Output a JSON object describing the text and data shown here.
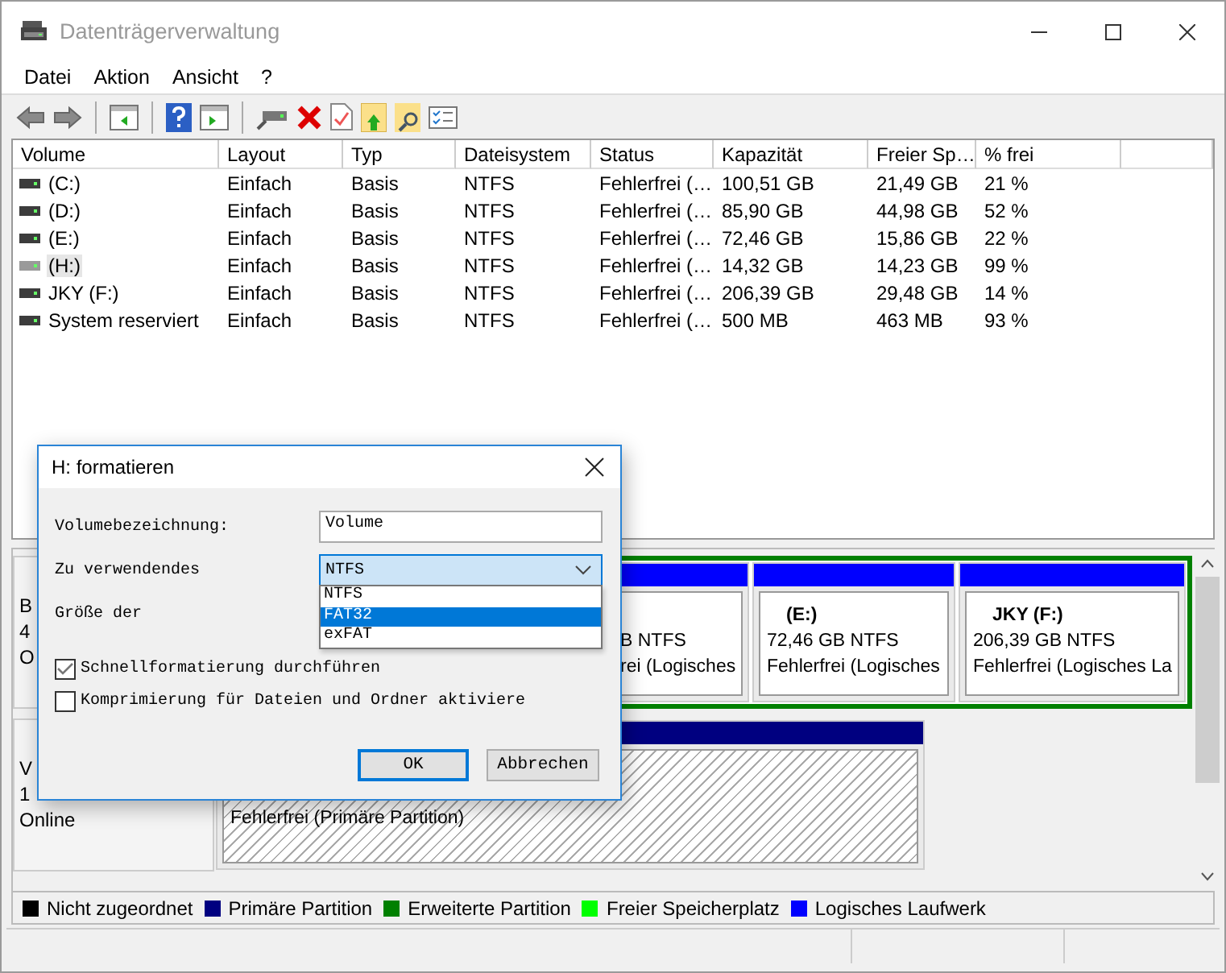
{
  "window": {
    "title": "Datenträgerverwaltung"
  },
  "menu": [
    "Datei",
    "Aktion",
    "Ansicht",
    "?"
  ],
  "volume_table": {
    "columns": [
      "Volume",
      "Layout",
      "Typ",
      "Dateisystem",
      "Status",
      "Kapazität",
      "Freier Sp…",
      "% frei"
    ],
    "rows": [
      {
        "volume": "(C:)",
        "layout": "Einfach",
        "type": "Basis",
        "filesystem": "NTFS",
        "status": "Fehlerfrei (…",
        "capacity": "100,51 GB",
        "free": "21,49 GB",
        "percent_free": "21 %",
        "selected": false
      },
      {
        "volume": "(D:)",
        "layout": "Einfach",
        "type": "Basis",
        "filesystem": "NTFS",
        "status": "Fehlerfrei (…",
        "capacity": "85,90 GB",
        "free": "44,98 GB",
        "percent_free": "52 %",
        "selected": false
      },
      {
        "volume": "(E:)",
        "layout": "Einfach",
        "type": "Basis",
        "filesystem": "NTFS",
        "status": "Fehlerfrei (…",
        "capacity": "72,46 GB",
        "free": "15,86 GB",
        "percent_free": "22 %",
        "selected": false
      },
      {
        "volume": "(H:)",
        "layout": "Einfach",
        "type": "Basis",
        "filesystem": "NTFS",
        "status": "Fehlerfrei (…",
        "capacity": "14,32 GB",
        "free": "14,23 GB",
        "percent_free": "99 %",
        "selected": true
      },
      {
        "volume": "JKY (F:)",
        "layout": "Einfach",
        "type": "Basis",
        "filesystem": "NTFS",
        "status": "Fehlerfrei (…",
        "capacity": "206,39 GB",
        "free": "29,48 GB",
        "percent_free": "14 %",
        "selected": false
      },
      {
        "volume": "System reserviert",
        "layout": "Einfach",
        "type": "Basis",
        "filesystem": "NTFS",
        "status": "Fehlerfrei (…",
        "capacity": "500 MB",
        "free": "463 MB",
        "percent_free": "93 %",
        "selected": false
      }
    ]
  },
  "disks": [
    {
      "labels": [
        "B",
        "4",
        "O"
      ],
      "extended": true,
      "partitions": [
        {
          "kind": "logical",
          "selected": false,
          "size": "B NTFS",
          "status": "rei (Logisches"
        },
        {
          "kind": "logical",
          "selected": false,
          "name": "(E:)",
          "size": "72,46 GB NTFS",
          "status": "Fehlerfrei (Logisches"
        },
        {
          "kind": "logical",
          "selected": false,
          "name": "JKY  (F:)",
          "size": "206,39 GB NTFS",
          "status": "Fehlerfrei (Logisches La"
        }
      ]
    },
    {
      "labels": [
        "V",
        "1",
        "Online"
      ],
      "extended": false,
      "partitions": [
        {
          "kind": "primary",
          "selected": true,
          "status": "Fehlerfrei (Primäre Partition)"
        }
      ]
    }
  ],
  "legend": [
    {
      "label": "Nicht zugeordnet",
      "color": "#000000"
    },
    {
      "label": "Primäre Partition",
      "color": "#000080"
    },
    {
      "label": "Erweiterte Partition",
      "color": "#008000"
    },
    {
      "label": "Freier Speicherplatz",
      "color": "#00ff00"
    },
    {
      "label": "Logisches Laufwerk",
      "color": "#0000ff"
    }
  ],
  "dialog": {
    "title": "H: formatieren",
    "fields": [
      {
        "kind": "text",
        "label": "Volumebezeichnung:",
        "value": "Volume"
      },
      {
        "kind": "select",
        "label": "Zu verwendendes",
        "value": "NTFS",
        "expanded": true,
        "options": [
          {
            "label": "NTFS",
            "highlighted": false
          },
          {
            "label": "FAT32",
            "highlighted": true
          },
          {
            "label": "exFAT",
            "highlighted": false
          }
        ]
      },
      {
        "kind": "label",
        "label": "Größe der"
      }
    ],
    "checkboxes": [
      {
        "label": "Schnellformatierung durchführen",
        "checked": true
      },
      {
        "label": "Komprimierung für Dateien und Ordner aktiviere",
        "checked": false
      }
    ],
    "buttons": [
      {
        "label": "OK",
        "default": true
      },
      {
        "label": "Abbrechen",
        "default": false
      }
    ]
  }
}
